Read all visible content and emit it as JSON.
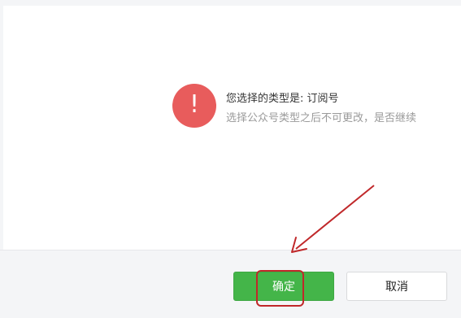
{
  "dialog": {
    "icon": "exclamation-icon",
    "title": "您选择的类型是: 订阅号",
    "message": "选择公众号类型之后不可更改，是否继续"
  },
  "footer": {
    "confirm_label": "确定",
    "cancel_label": "取消"
  },
  "colors": {
    "alert_red": "#e85c5c",
    "confirm_green": "#44b549",
    "annotation_red": "#c0282a"
  }
}
